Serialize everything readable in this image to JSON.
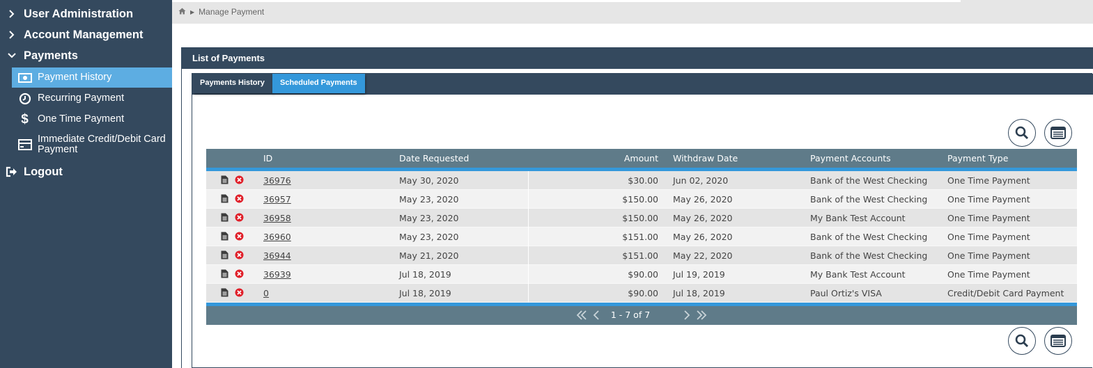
{
  "sidebar": {
    "items": [
      {
        "label": "User Administration"
      },
      {
        "label": "Account Management"
      },
      {
        "label": "Payments"
      }
    ],
    "sub_items": [
      {
        "label": "Payment History"
      },
      {
        "label": "Recurring Payment"
      },
      {
        "label": "One Time Payment"
      },
      {
        "label": "Immediate Credit/Debit Card Payment"
      }
    ],
    "logout_label": "Logout"
  },
  "breadcrumb": {
    "current": "Manage Payment"
  },
  "panel": {
    "title": "List of Payments"
  },
  "tabs": [
    {
      "label": "Payments History"
    },
    {
      "label": "Scheduled Payments"
    }
  ],
  "table": {
    "columns": [
      "ID",
      "Date Requested",
      "Amount",
      "Withdraw Date",
      "Payment Accounts",
      "Payment Type"
    ],
    "rows": [
      {
        "id": "36976",
        "requested": "May 30, 2020",
        "amount": "$30.00",
        "withdraw": "Jun 02, 2020",
        "account": "Bank of the West Checking",
        "type": "One Time Payment"
      },
      {
        "id": "36957",
        "requested": "May 23, 2020",
        "amount": "$150.00",
        "withdraw": "May 26, 2020",
        "account": "Bank of the West Checking",
        "type": "One Time Payment"
      },
      {
        "id": "36958",
        "requested": "May 23, 2020",
        "amount": "$150.00",
        "withdraw": "May 26, 2020",
        "account": "My Bank Test Account",
        "type": "One Time Payment"
      },
      {
        "id": "36960",
        "requested": "May 23, 2020",
        "amount": "$151.00",
        "withdraw": "May 26, 2020",
        "account": "Bank of the West Checking",
        "type": "One Time Payment"
      },
      {
        "id": "36944",
        "requested": "May 21, 2020",
        "amount": "$151.00",
        "withdraw": "May 22, 2020",
        "account": "Bank of the West Checking",
        "type": "One Time Payment"
      },
      {
        "id": "36939",
        "requested": "Jul 18, 2019",
        "amount": "$90.00",
        "withdraw": "Jul 19, 2019",
        "account": "My Bank Test Account",
        "type": "One Time Payment"
      },
      {
        "id": "0",
        "requested": "Jul 18, 2019",
        "amount": "$90.00",
        "withdraw": "Jul 18, 2019",
        "account": "Paul Ortiz's VISA",
        "type": "Credit/Debit Card Payment"
      }
    ]
  },
  "pager": {
    "text": "1 - 7 of 7"
  },
  "colors": {
    "sidebar": "#34495e",
    "accent": "#3498db",
    "active": "#5dade2",
    "grid_header": "#5f7b89",
    "delete": "#e0202a"
  }
}
